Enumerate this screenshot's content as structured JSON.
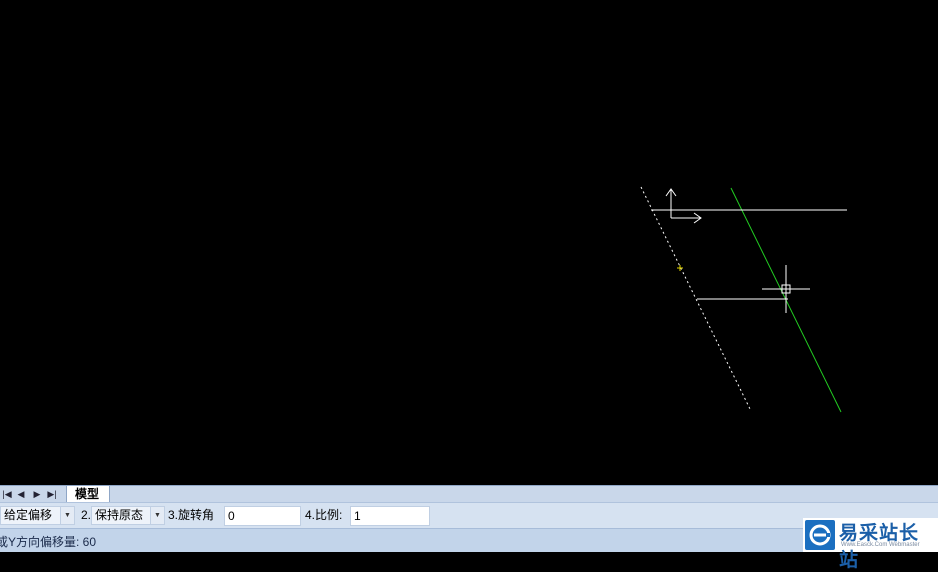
{
  "tabs": {
    "nav": [
      "|◀",
      "◀",
      "▶",
      "▶|"
    ],
    "model_tab": "模型"
  },
  "options": {
    "mode": "给定偏移",
    "opt2_label": "2.",
    "opt2_value": "保持原态",
    "rotate_label": "3.旋转角",
    "rotate_value": "0",
    "scale_label": "4.比例:",
    "scale_value": "1"
  },
  "status": {
    "prompt": "或Y方向偏移量: 60"
  },
  "watermark": {
    "name": "易采站长站",
    "sub": "Www.Easck.Com Webmaster"
  },
  "colors": {
    "canvas_bg": "#000000",
    "entity_white": "#ffffff",
    "entity_green": "#22cc22",
    "snap_yellow": "#e6d800"
  }
}
